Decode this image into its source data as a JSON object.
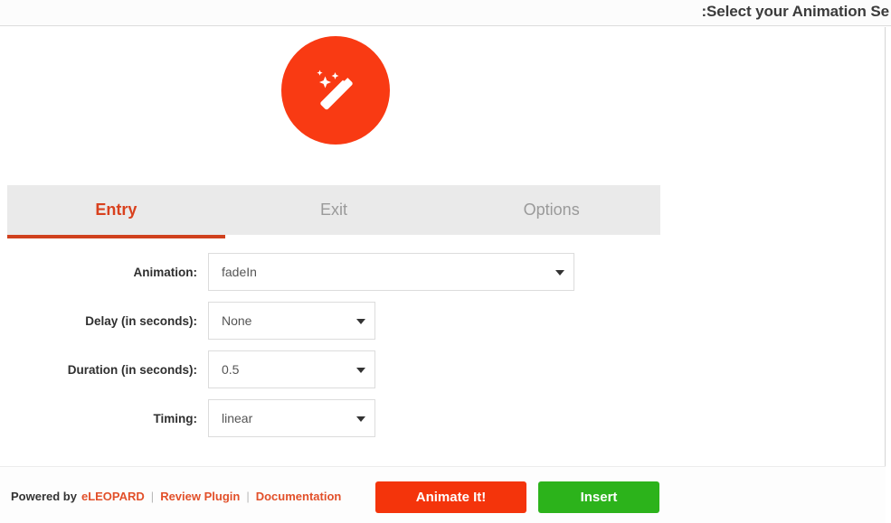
{
  "window": {
    "title": ":Select your Animation Se"
  },
  "hero": {
    "icon": "magic-wand-icon",
    "circle_color": "#f93a13"
  },
  "tabs": [
    {
      "label": "Entry",
      "active": true
    },
    {
      "label": "Exit",
      "active": false
    },
    {
      "label": "Options",
      "active": false
    }
  ],
  "form": {
    "animation": {
      "label": "Animation:",
      "value": "fadeIn"
    },
    "delay": {
      "label": "Delay (in seconds):",
      "value": "None"
    },
    "duration": {
      "label": "Duration (in seconds):",
      "value": "0.5"
    },
    "timing": {
      "label": "Timing:",
      "value": "linear"
    }
  },
  "footer": {
    "powered_by": "Powered by",
    "brand": "eLEOPARD",
    "sep1": "|",
    "review_link": "Review Plugin",
    "sep2": "|",
    "docs_link": "Documentation",
    "animate_button": "Animate It!",
    "insert_button": "Insert",
    "accent_color": "#e2502a",
    "animate_color": "#f4340b",
    "insert_color": "#2cb31b"
  }
}
